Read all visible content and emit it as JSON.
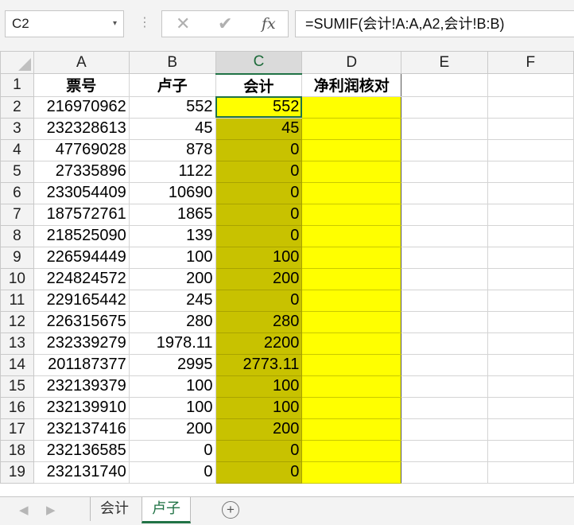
{
  "formula_bar": {
    "name_box": "C2",
    "name_box_arrow": "▾",
    "separator": "⋮",
    "cancel_glyph": "✕",
    "enter_glyph": "✔",
    "function_glyph": "fx",
    "formula": "=SUMIF(会计!A:A,A2,会计!B:B)"
  },
  "columns": [
    "A",
    "B",
    "C",
    "D",
    "E",
    "F"
  ],
  "header_row": {
    "row_number": "1",
    "A": "票号",
    "B": "卢子",
    "C": "会计",
    "D": "净利润核对"
  },
  "rows": [
    {
      "n": "2",
      "a": "216970962",
      "b": "552",
      "c": "552"
    },
    {
      "n": "3",
      "a": "232328613",
      "b": "45",
      "c": "45"
    },
    {
      "n": "4",
      "a": "47769028",
      "b": "878",
      "c": "0"
    },
    {
      "n": "5",
      "a": "27335896",
      "b": "1122",
      "c": "0"
    },
    {
      "n": "6",
      "a": "233054409",
      "b": "10690",
      "c": "0"
    },
    {
      "n": "7",
      "a": "187572761",
      "b": "1865",
      "c": "0"
    },
    {
      "n": "8",
      "a": "218525090",
      "b": "139",
      "c": "0"
    },
    {
      "n": "9",
      "a": "226594449",
      "b": "100",
      "c": "100"
    },
    {
      "n": "10",
      "a": "224824572",
      "b": "200",
      "c": "200"
    },
    {
      "n": "11",
      "a": "229165442",
      "b": "245",
      "c": "0"
    },
    {
      "n": "12",
      "a": "226315675",
      "b": "280",
      "c": "280"
    },
    {
      "n": "13",
      "a": "232339279",
      "b": "1978.11",
      "c": "2200"
    },
    {
      "n": "14",
      "a": "201187377",
      "b": "2995",
      "c": "2773.11"
    },
    {
      "n": "15",
      "a": "232139379",
      "b": "100",
      "c": "100"
    },
    {
      "n": "16",
      "a": "232139910",
      "b": "100",
      "c": "100"
    },
    {
      "n": "17",
      "a": "232137416",
      "b": "200",
      "c": "200"
    },
    {
      "n": "18",
      "a": "232136585",
      "b": "0",
      "c": "0"
    },
    {
      "n": "19",
      "a": "232131740",
      "b": "0",
      "c": "0"
    }
  ],
  "sheet_tabs": {
    "prev_glyph": "◀",
    "next_glyph": "▶",
    "tabs": [
      "会计",
      "卢子"
    ],
    "active_tab": "卢子",
    "add_glyph": "+"
  },
  "colors": {
    "accent": "#217346",
    "yellow_fill": "#ffff00",
    "olive_fill": "#c8c200"
  }
}
